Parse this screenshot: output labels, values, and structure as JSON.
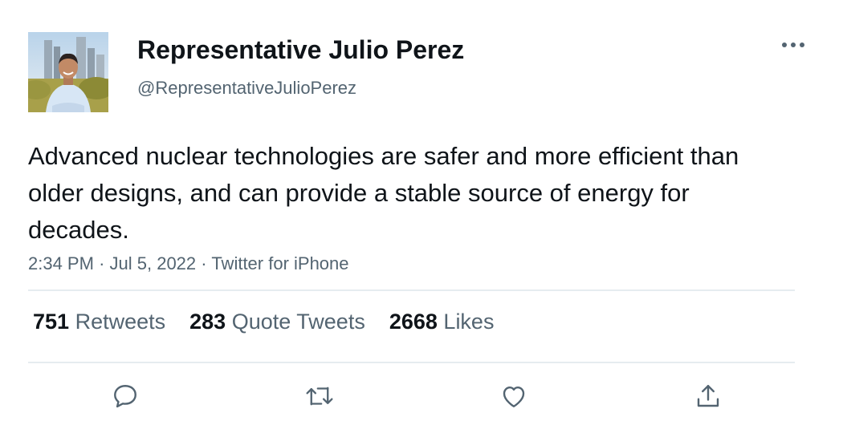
{
  "author": {
    "display_name": "Representative Julio Perez",
    "handle": "@RepresentativeJulioPerez",
    "avatar_icon": "profile-photo"
  },
  "tweet": {
    "text": "Advanced nuclear technologies are safer and more efficient than older designs, and can provide a stable source of energy for decades.",
    "time": "2:34 PM",
    "date": "Jul 5, 2022",
    "source": "Twitter for iPhone",
    "separator": "·"
  },
  "stats": {
    "retweets": {
      "count": "751",
      "label": "Retweets"
    },
    "quotes": {
      "count": "283",
      "label": "Quote Tweets"
    },
    "likes": {
      "count": "2668",
      "label": "Likes"
    }
  },
  "actions": [
    "reply-icon",
    "retweet-icon",
    "like-icon",
    "share-icon"
  ],
  "colors": {
    "text_primary": "#0f1419",
    "text_secondary": "#536471",
    "divider": "#e6ecf0"
  }
}
